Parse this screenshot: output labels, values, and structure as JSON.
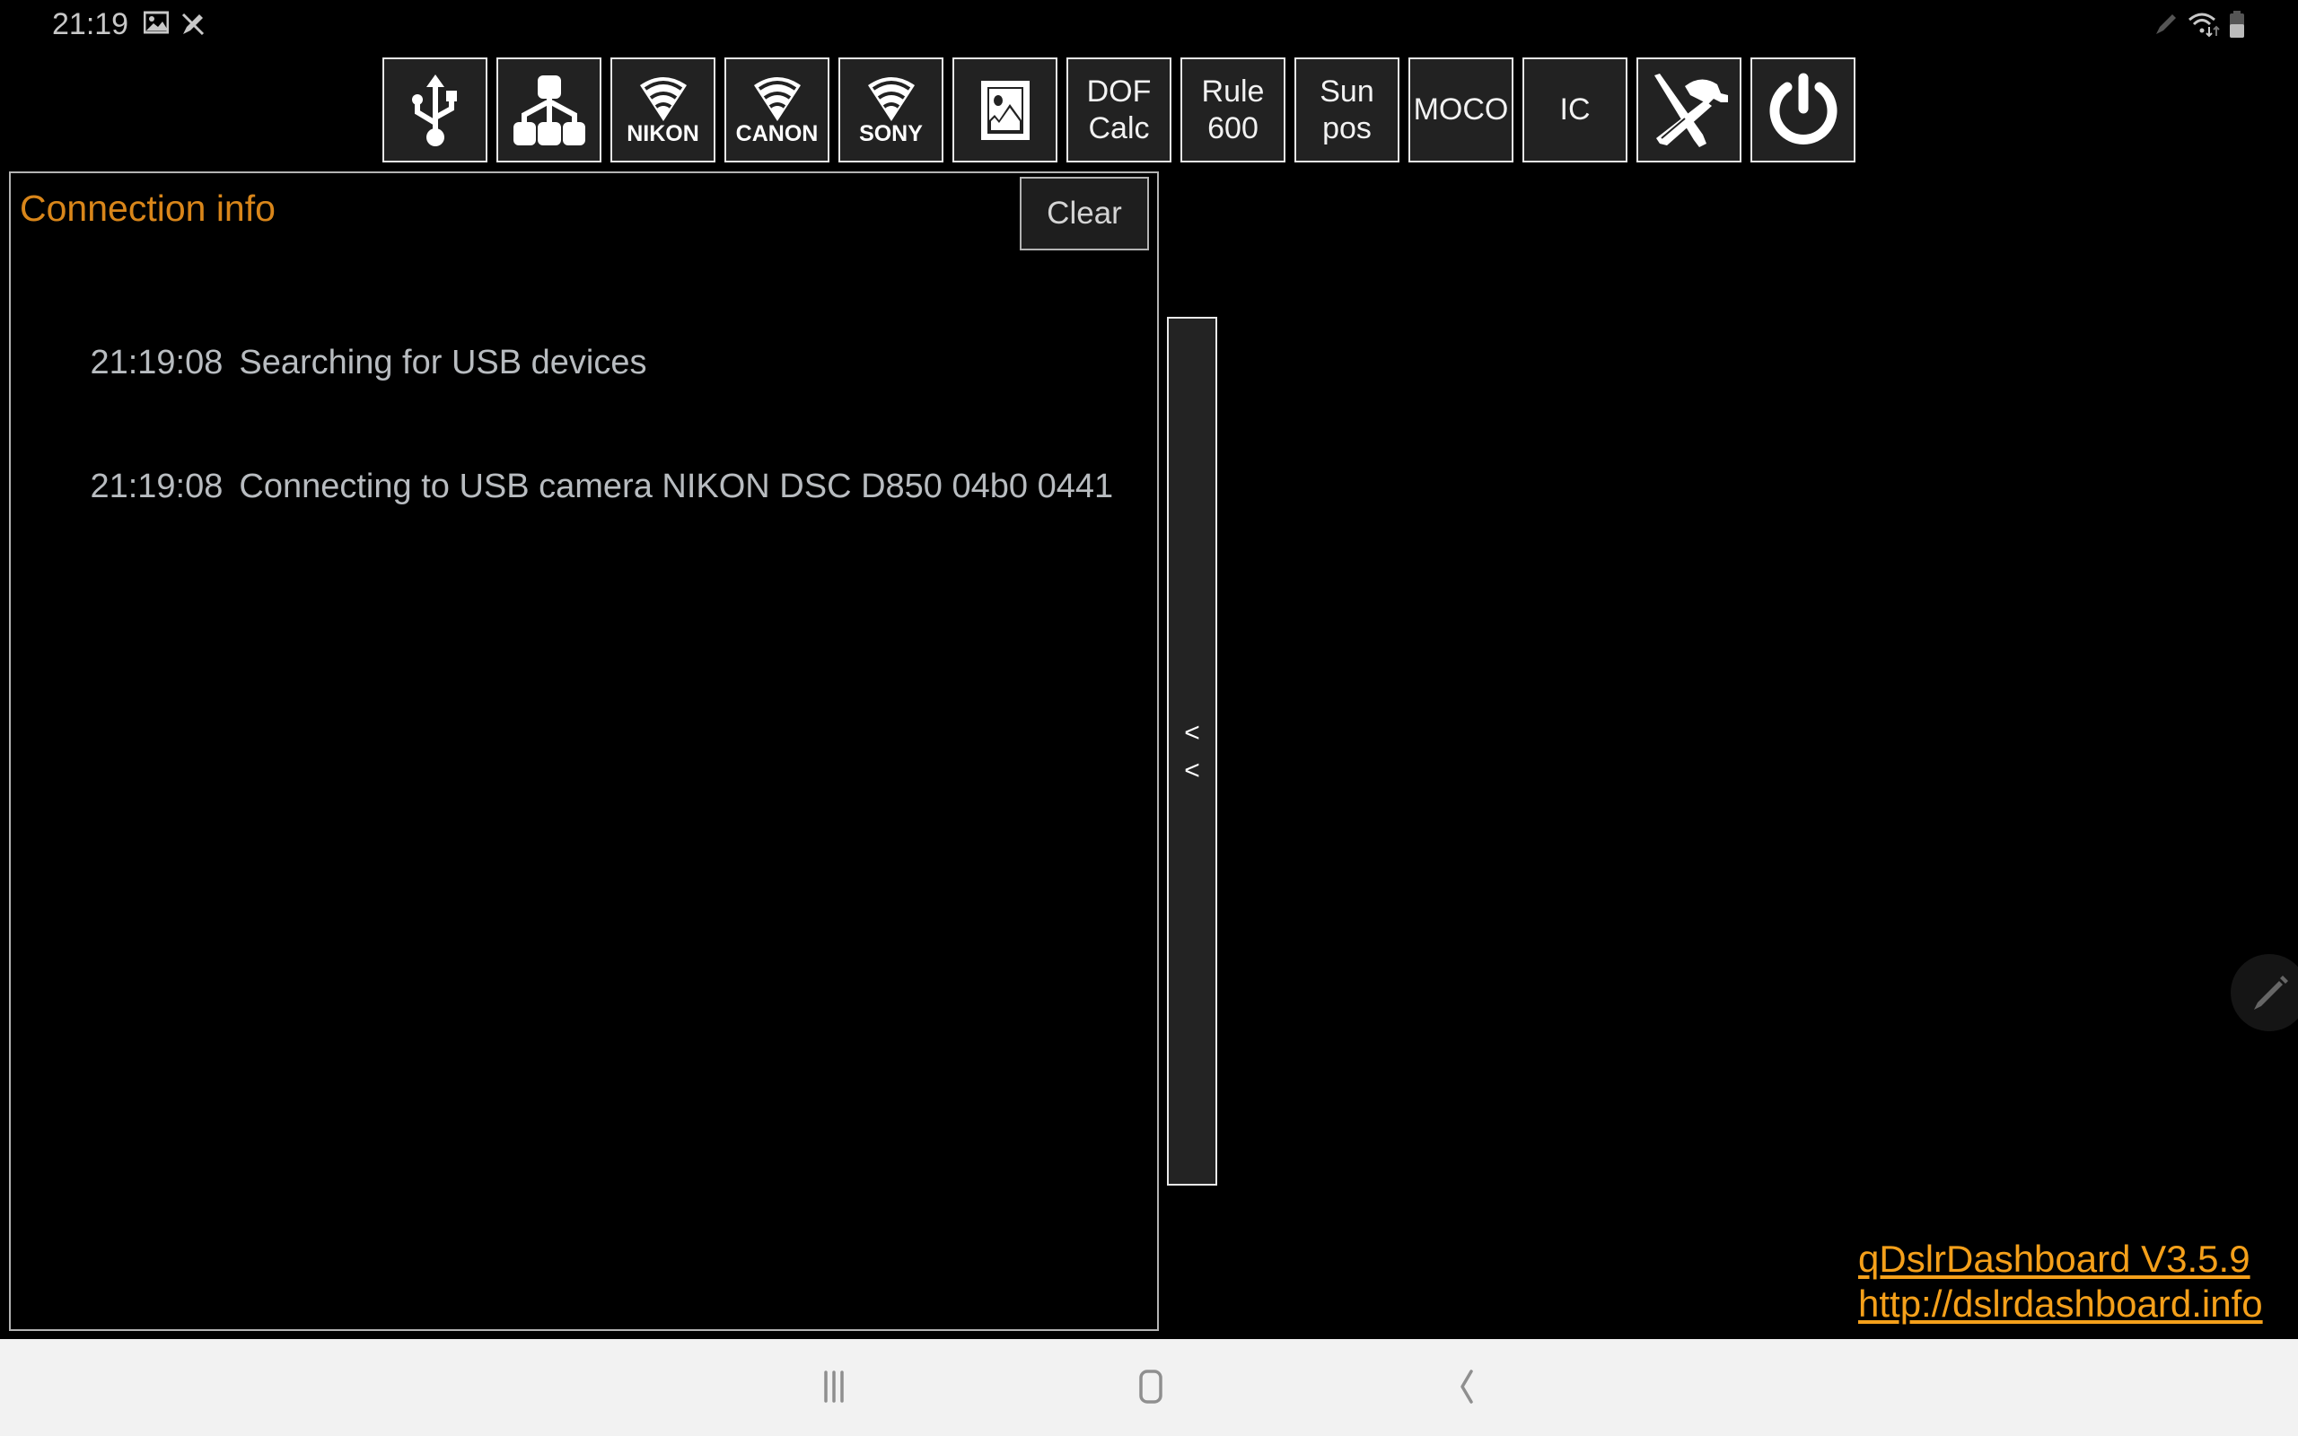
{
  "status_bar": {
    "time": "21:19",
    "left_icons": [
      "image-notification-icon",
      "no-pen-icon"
    ],
    "right_icons": [
      "pen-icon",
      "wifi-icon",
      "battery-icon"
    ]
  },
  "toolbar": {
    "buttons": [
      {
        "name": "usb",
        "icon": "usb-icon",
        "label": ""
      },
      {
        "name": "network",
        "icon": "network-icon",
        "label": ""
      },
      {
        "name": "nikon-wifi",
        "icon": "wifi-icon",
        "label": "NIKON"
      },
      {
        "name": "canon-wifi",
        "icon": "wifi-icon",
        "label": "CANON"
      },
      {
        "name": "sony-wifi",
        "icon": "wifi-icon",
        "label": "SONY"
      },
      {
        "name": "gallery",
        "icon": "image-icon",
        "label": ""
      },
      {
        "name": "dof-calc",
        "icon": "",
        "label": "DOF\nCalc"
      },
      {
        "name": "rule-600",
        "icon": "",
        "label": "Rule\n600"
      },
      {
        "name": "sun-pos",
        "icon": "",
        "label": "Sun\npos"
      },
      {
        "name": "moco",
        "icon": "",
        "label": "MOCO"
      },
      {
        "name": "ic",
        "icon": "",
        "label": "IC"
      },
      {
        "name": "tools",
        "icon": "tools-icon",
        "label": ""
      },
      {
        "name": "power",
        "icon": "power-icon",
        "label": ""
      }
    ]
  },
  "connection_panel": {
    "title": "Connection info",
    "clear_label": "Clear",
    "log": [
      {
        "time": "21:19:08",
        "message": "Searching for USB devices"
      },
      {
        "time": "21:19:08",
        "message": "Connecting to USB camera NIKON DSC D850 04b0 0441"
      }
    ]
  },
  "collapse_handle": {
    "arrows": [
      "<",
      "<"
    ]
  },
  "footer_links": {
    "version": "qDslrDashboard V3.5.9",
    "url": "http://dslrdashboard.info"
  },
  "nav_bar": {
    "buttons": [
      "recents-icon",
      "home-icon",
      "back-icon"
    ]
  },
  "colors": {
    "accent_orange": "#d9861a",
    "link_orange": "#f5a01a",
    "button_bg": "#222222",
    "log_text": "#b8bcc0"
  }
}
